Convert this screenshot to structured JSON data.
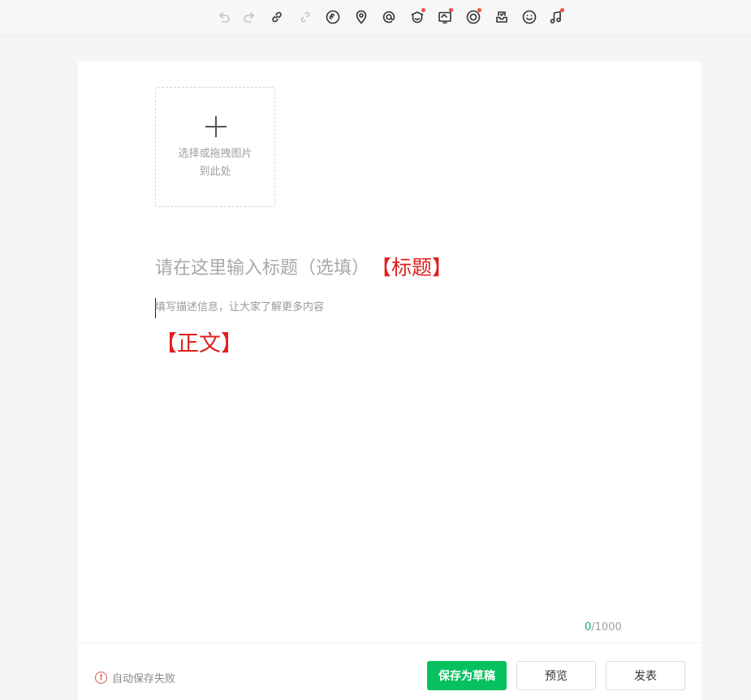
{
  "toolbar": {
    "tools": [
      {
        "name": "undo-icon",
        "disabled": true,
        "dot": false
      },
      {
        "name": "redo-icon",
        "disabled": true,
        "dot": false
      },
      {
        "name": "link-icon",
        "disabled": false,
        "dot": false
      },
      {
        "name": "unlink-icon",
        "disabled": true,
        "dot": false
      },
      {
        "name": "mini-program-icon",
        "disabled": false,
        "dot": false
      },
      {
        "name": "location-icon",
        "disabled": false,
        "dot": false
      },
      {
        "name": "mention-icon",
        "disabled": false,
        "dot": false
      },
      {
        "name": "profile-card-icon",
        "disabled": false,
        "dot": true
      },
      {
        "name": "image-card-icon",
        "disabled": false,
        "dot": true
      },
      {
        "name": "live-icon",
        "disabled": false,
        "dot": true
      },
      {
        "name": "inbox-icon",
        "disabled": false,
        "dot": false
      },
      {
        "name": "emoji-icon",
        "disabled": false,
        "dot": false
      },
      {
        "name": "music-icon",
        "disabled": false,
        "dot": true
      }
    ],
    "dot_color": "#f04a3a"
  },
  "uploader": {
    "line1": "选择或拖拽图片",
    "line2": "到此处"
  },
  "editor": {
    "title_placeholder": "请在这里输入标题（选填）",
    "title_tag": "【标题】",
    "desc_placeholder": "填写描述信息，让大家了解更多内容",
    "body_tag": "【正文】",
    "count": "0",
    "max": "/1000"
  },
  "footer": {
    "status": "自动保存失败",
    "save_draft": "保存为草稿",
    "preview": "预览",
    "publish": "发表"
  },
  "colors": {
    "accent": "#07c160",
    "tag_red": "#e01f1f",
    "warn": "#e25252"
  }
}
